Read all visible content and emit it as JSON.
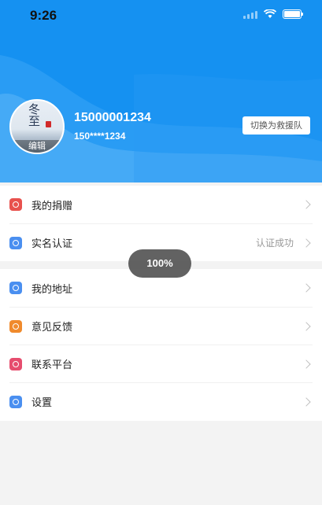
{
  "status_bar": {
    "time": "9:26"
  },
  "profile": {
    "phone": "15000001234",
    "masked_phone": "150****1234",
    "avatar_edit_label": "编辑",
    "avatar_art_text": "冬至",
    "switch_button_label": "切换为救援队"
  },
  "menu_group_1": [
    {
      "label": "我的捐赠",
      "icon": "gift-icon",
      "color": "#e8514d",
      "value": ""
    },
    {
      "label": "实名认证",
      "icon": "verify-icon",
      "color": "#4a8ff0",
      "value": "认证成功"
    }
  ],
  "menu_group_2": [
    {
      "label": "我的地址",
      "icon": "location-icon",
      "color": "#4a8ff0"
    },
    {
      "label": "意见反馈",
      "icon": "feedback-icon",
      "color": "#f08a2c"
    },
    {
      "label": "联系平台",
      "icon": "contact-icon",
      "color": "#e64d6e"
    },
    {
      "label": "设置",
      "icon": "settings-icon",
      "color": "#4a8ff0"
    }
  ],
  "toast": {
    "text": "100%"
  },
  "colors": {
    "header_blue": "#1591f1",
    "page_bg": "#f3f3f3"
  }
}
